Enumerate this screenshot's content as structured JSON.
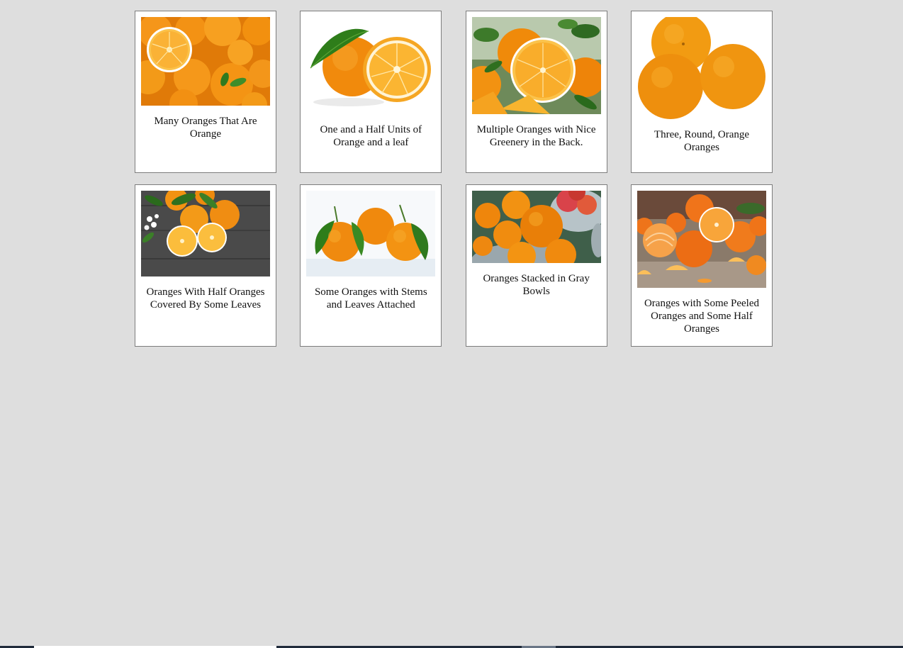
{
  "gallery": {
    "items": [
      {
        "caption": "Many Oranges That Are Orange",
        "image": "orange-pile-photo"
      },
      {
        "caption": "One and a Half Units of Orange and a leaf",
        "image": "orange-half-leaf-photo"
      },
      {
        "caption": "Multiple Oranges with Nice Greenery in the Back.",
        "image": "oranges-greenery-photo"
      },
      {
        "caption": "Three, Round, Orange Oranges",
        "image": "three-oranges-photo"
      },
      {
        "caption": "Oranges With Half Oranges Covered By Some Leaves",
        "image": "oranges-dark-wood-photo"
      },
      {
        "caption": "Some Oranges with Stems and Leaves Attached",
        "image": "oranges-stems-photo"
      },
      {
        "caption": "Oranges Stacked in Gray Bowls",
        "image": "oranges-bowls-photo"
      },
      {
        "caption": "Oranges with Some Peeled Oranges and Some Half Oranges",
        "image": "peeled-oranges-photo"
      }
    ]
  },
  "colors": {
    "background": "#dedede",
    "card_border": "#7d7d7d",
    "orange": "#f28c0f",
    "leaf": "#2f7a1f"
  }
}
